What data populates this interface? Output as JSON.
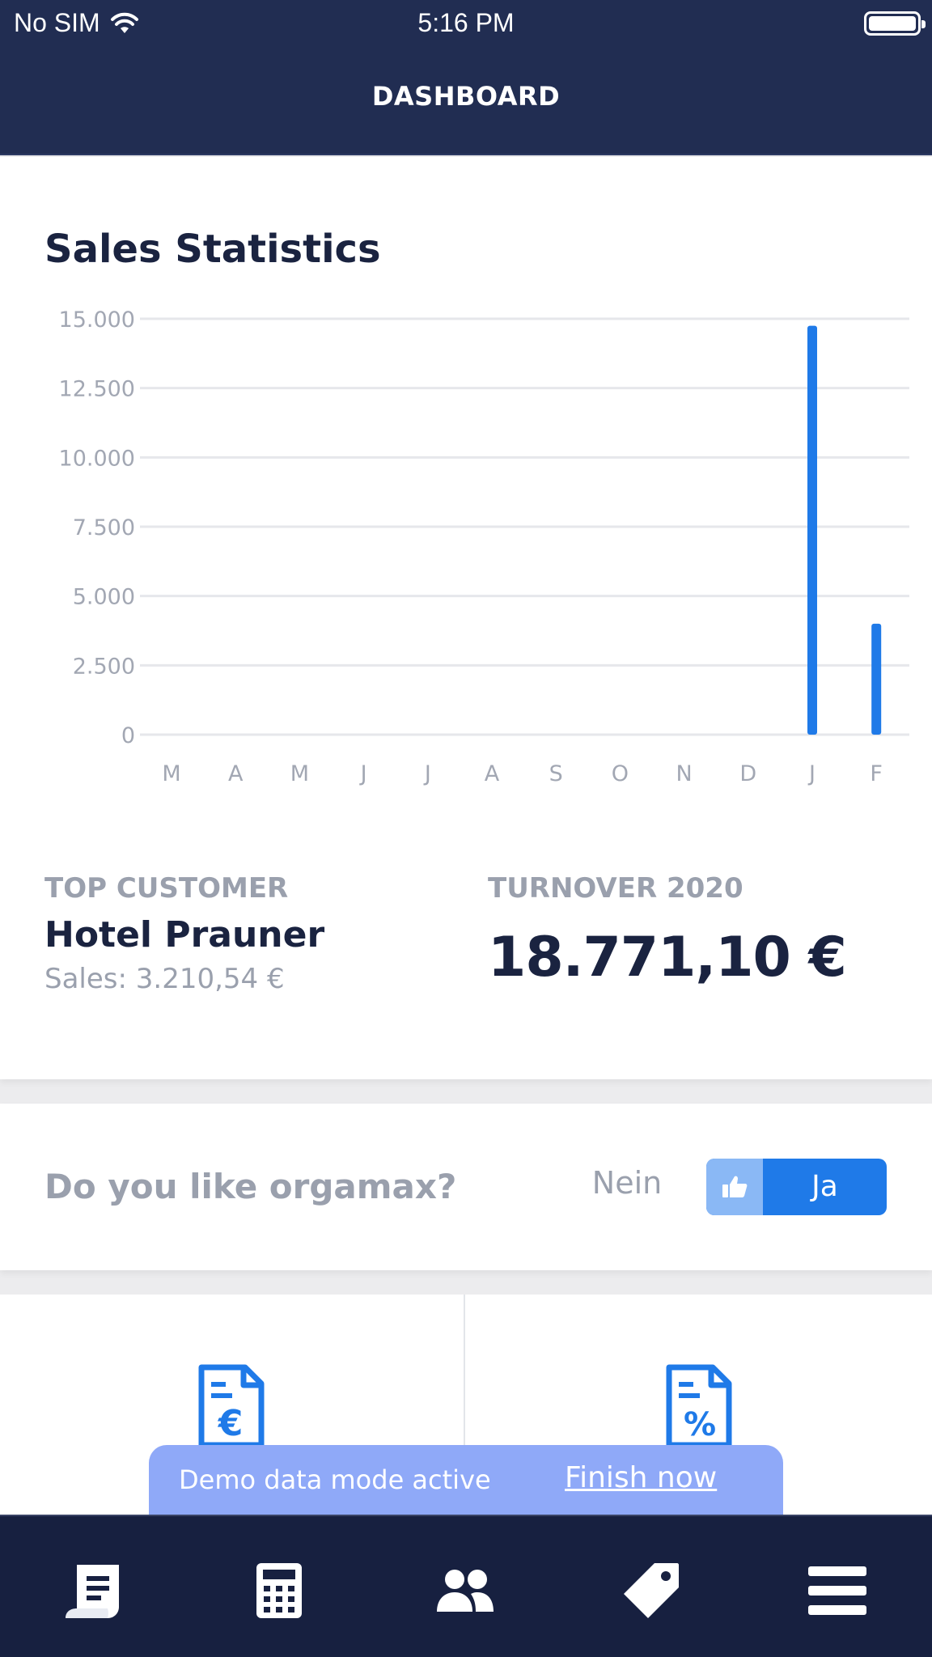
{
  "status_bar": {
    "carrier": "No SIM",
    "time": "5:16 PM"
  },
  "header": {
    "title": "DASHBOARD"
  },
  "stats": {
    "title": "Sales Statistics",
    "top_customer_label": "TOP CUSTOMER",
    "top_customer_name": "Hotel Prauner",
    "top_customer_sales": "Sales: 3.210,54 €",
    "turnover_label": "TURNOVER 2020",
    "turnover_value": "18.771,10 €"
  },
  "chart_data": {
    "type": "bar",
    "title": "Sales Statistics",
    "categories": [
      "M",
      "A",
      "M",
      "J",
      "J",
      "A",
      "S",
      "O",
      "N",
      "D",
      "J",
      "F"
    ],
    "values": [
      0,
      0,
      0,
      0,
      0,
      0,
      0,
      0,
      0,
      0,
      14750,
      4000
    ],
    "y_ticks": [
      "15.000",
      "12.500",
      "10.000",
      "7.500",
      "5.000",
      "2.500",
      "0"
    ],
    "ylim": [
      0,
      15000
    ],
    "grid": true,
    "bar_color": "#1f7ae8"
  },
  "feedback": {
    "question": "Do you like orgamax?",
    "no_label": "Nein",
    "yes_label": "Ja"
  },
  "tiles": [
    {
      "icon": "invoice-euro-icon"
    },
    {
      "icon": "invoice-percent-icon"
    }
  ],
  "demo_banner": {
    "text": "Demo data mode active",
    "link": "Finish now"
  },
  "tabbar": {
    "items": [
      {
        "icon": "receipt-icon"
      },
      {
        "icon": "calculator-icon"
      },
      {
        "icon": "contacts-icon"
      },
      {
        "icon": "tag-icon"
      },
      {
        "icon": "menu-icon"
      }
    ]
  },
  "colors": {
    "header": "#212d52",
    "accent": "#1f7ae8",
    "tabbar": "#172040",
    "banner": "#8fa9f8"
  }
}
